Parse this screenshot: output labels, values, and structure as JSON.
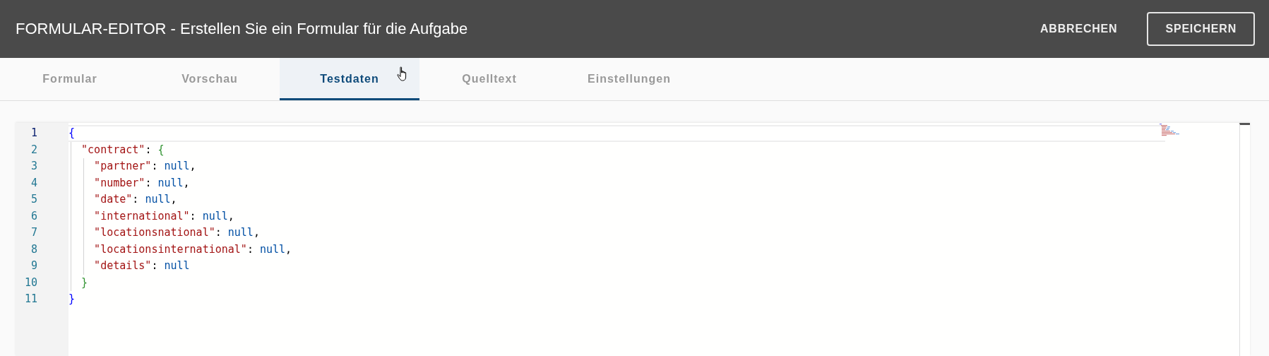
{
  "header": {
    "title": "FORMULAR-EDITOR - Erstellen Sie ein Formular für die Aufgabe",
    "buttons": [
      {
        "label": "ABBRECHEN",
        "kind": "text"
      },
      {
        "label": "SPEICHERN",
        "kind": "outlined"
      }
    ]
  },
  "tabs": [
    {
      "label": "Formular",
      "selected": false
    },
    {
      "label": "Vorschau",
      "selected": false
    },
    {
      "label": "Testdaten",
      "selected": true
    },
    {
      "label": "Quelltext",
      "selected": false
    },
    {
      "label": "Einstellungen",
      "selected": false
    }
  ],
  "editor": {
    "lines": [
      {
        "number": "1",
        "current": true,
        "tokens": [
          {
            "kind": "bracket1",
            "text": "{"
          }
        ]
      },
      {
        "number": "2",
        "current": false,
        "tokens": [
          {
            "kind": "key",
            "text": "  \"contract\""
          },
          {
            "kind": "punct",
            "text": ": "
          },
          {
            "kind": "bracket2",
            "text": "{"
          }
        ]
      },
      {
        "number": "3",
        "current": false,
        "tokens": [
          {
            "kind": "key",
            "text": "    \"partner\""
          },
          {
            "kind": "punct",
            "text": ": "
          },
          {
            "kind": "null",
            "text": "null"
          },
          {
            "kind": "punct",
            "text": ","
          }
        ]
      },
      {
        "number": "4",
        "current": false,
        "tokens": [
          {
            "kind": "key",
            "text": "    \"number\""
          },
          {
            "kind": "punct",
            "text": ": "
          },
          {
            "kind": "null",
            "text": "null"
          },
          {
            "kind": "punct",
            "text": ","
          }
        ]
      },
      {
        "number": "5",
        "current": false,
        "tokens": [
          {
            "kind": "key",
            "text": "    \"date\""
          },
          {
            "kind": "punct",
            "text": ": "
          },
          {
            "kind": "null",
            "text": "null"
          },
          {
            "kind": "punct",
            "text": ","
          }
        ]
      },
      {
        "number": "6",
        "current": false,
        "tokens": [
          {
            "kind": "key",
            "text": "    \"international\""
          },
          {
            "kind": "punct",
            "text": ": "
          },
          {
            "kind": "null",
            "text": "null"
          },
          {
            "kind": "punct",
            "text": ","
          }
        ]
      },
      {
        "number": "7",
        "current": false,
        "tokens": [
          {
            "kind": "key",
            "text": "    \"locationsnational\""
          },
          {
            "kind": "punct",
            "text": ": "
          },
          {
            "kind": "null",
            "text": "null"
          },
          {
            "kind": "punct",
            "text": ","
          }
        ]
      },
      {
        "number": "8",
        "current": false,
        "tokens": [
          {
            "kind": "key",
            "text": "    \"locationsinternational\""
          },
          {
            "kind": "punct",
            "text": ": "
          },
          {
            "kind": "null",
            "text": "null"
          },
          {
            "kind": "punct",
            "text": ","
          }
        ]
      },
      {
        "number": "9",
        "current": false,
        "tokens": [
          {
            "kind": "key",
            "text": "    \"details\""
          },
          {
            "kind": "punct",
            "text": ": "
          },
          {
            "kind": "null",
            "text": "null"
          }
        ]
      },
      {
        "number": "10",
        "current": false,
        "tokens": [
          {
            "kind": "bracket2",
            "text": "  }"
          }
        ]
      },
      {
        "number": "11",
        "current": false,
        "tokens": [
          {
            "kind": "bracket1",
            "text": "}"
          }
        ]
      }
    ]
  }
}
